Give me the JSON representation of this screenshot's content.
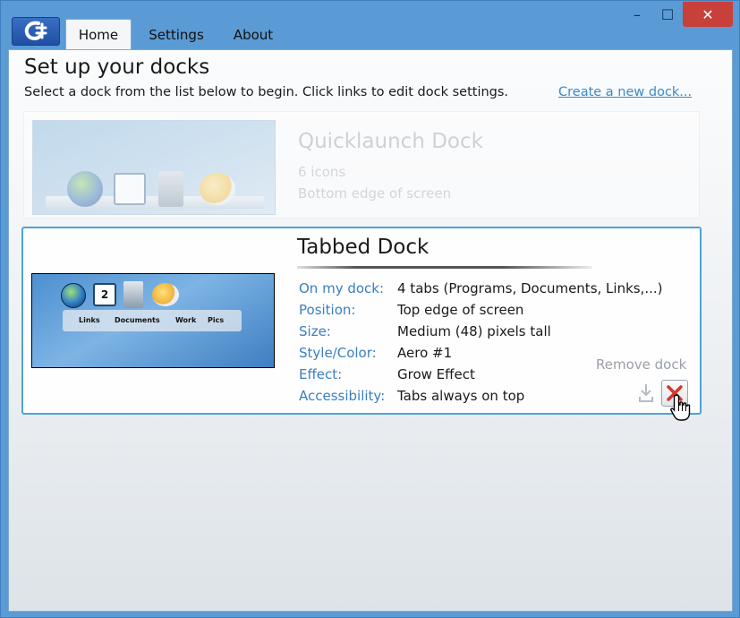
{
  "tabs": [
    {
      "label": "Home",
      "active": true
    },
    {
      "label": "Settings",
      "active": false
    },
    {
      "label": "About",
      "active": false
    }
  ],
  "window_controls": {
    "minimize": "–",
    "maximize": "☐",
    "close": "✕"
  },
  "header": {
    "title": "Set up your docks",
    "subtitle": "Select a dock from the list below to begin. Click links to edit dock settings.",
    "create_link": "Create a new dock..."
  },
  "docks": [
    {
      "name": "Quicklaunch Dock",
      "line1": "6 icons",
      "line2": "Bottom edge of screen",
      "selected": false
    },
    {
      "name": "Tabbed Dock",
      "selected": true,
      "thumbnail_tabs": [
        "Links",
        "Documents",
        "Work",
        "Pics"
      ],
      "properties": [
        {
          "label": "On my dock:",
          "value": "4 tabs (Programs, Documents, Links,...)"
        },
        {
          "label": "Position:",
          "value": "Top edge of screen"
        },
        {
          "label": "Size:",
          "value": "Medium (48) pixels tall"
        },
        {
          "label": "Style/Color:",
          "value": "Aero #1"
        },
        {
          "label": "Effect:",
          "value": "Grow Effect"
        },
        {
          "label": "Accessibility:",
          "value": "Tabs always on top"
        }
      ],
      "remove_label": "Remove dock",
      "calendar_day": "2"
    }
  ],
  "colors": {
    "frame": "#5b9bd5",
    "link": "#3a8ac8",
    "label": "#3a7fbf",
    "selection_border": "#4fa3d6",
    "close_button": "#c7403a",
    "remove_x": "#d9342b"
  },
  "icons": [
    "app-logo-icon",
    "windows-orb-icon",
    "calendar-icon",
    "folder-icon",
    "weather-icon",
    "export-icon",
    "remove-x-icon",
    "hand-cursor-icon"
  ]
}
